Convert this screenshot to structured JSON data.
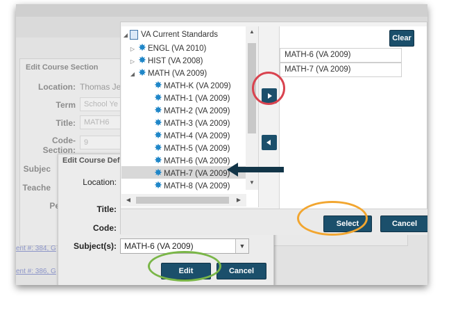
{
  "background_dialog": {
    "title": "Edit Course Section",
    "location_label": "Location:",
    "location_value": "Thomas Je",
    "term_label": "Term",
    "term_placeholder": "School Ye",
    "title_label": "Title:",
    "title_value": "MATH6",
    "code_section_label_1": "Code-",
    "code_section_label_2": "Section:",
    "code_section_value": "9",
    "subject_label": "Subjec",
    "teacher_label": "Teache",
    "period_label": "Pe",
    "link_1": "ent #: 384, G",
    "link_2": "ent #: 386, G"
  },
  "middle_dialog": {
    "title": "Edit Course Def",
    "location_label": "Location:",
    "title_label": "Title:",
    "code_label": "Code:",
    "subjects_label": "Subject(s):",
    "subjects_value": "MATH-6 (VA 2009)",
    "edit_button": "Edit",
    "cancel_button": "Cancel"
  },
  "tree": {
    "root": "VA Current Standards",
    "groups": [
      {
        "label": "ENGL (VA 2010)",
        "expanded": false
      },
      {
        "label": "HIST (VA 2008)",
        "expanded": false
      },
      {
        "label": "MATH (VA 2009)",
        "expanded": true
      }
    ],
    "math_items": [
      "MATH-K (VA 2009)",
      "MATH-1 (VA 2009)",
      "MATH-2 (VA 2009)",
      "MATH-3 (VA 2009)",
      "MATH-4 (VA 2009)",
      "MATH-5 (VA 2009)",
      "MATH-6 (VA 2009)",
      "MATH-7 (VA 2009)",
      "MATH-8 (VA 2009)"
    ],
    "selected": "MATH-7 (VA 2009)"
  },
  "selected_list": {
    "clear_button": "Clear",
    "items": [
      "MATH-6 (VA 2009)",
      "MATH-7 (VA 2009)"
    ]
  },
  "footer": {
    "select_button": "Select",
    "cancel_button": "Cancel"
  },
  "icons": {
    "add_arrow": "triangle-right",
    "remove_arrow": "triangle-left",
    "expander_collapsed": "▷",
    "expander_expanded": "◢",
    "standard": "✸"
  },
  "colors": {
    "button_bg": "#1b4f6b",
    "annotation_red": "#d9434f",
    "annotation_orange": "#f2a630",
    "annotation_green": "#7ab648",
    "annotation_arrow": "#123548",
    "star_blue": "#1f86c8"
  }
}
